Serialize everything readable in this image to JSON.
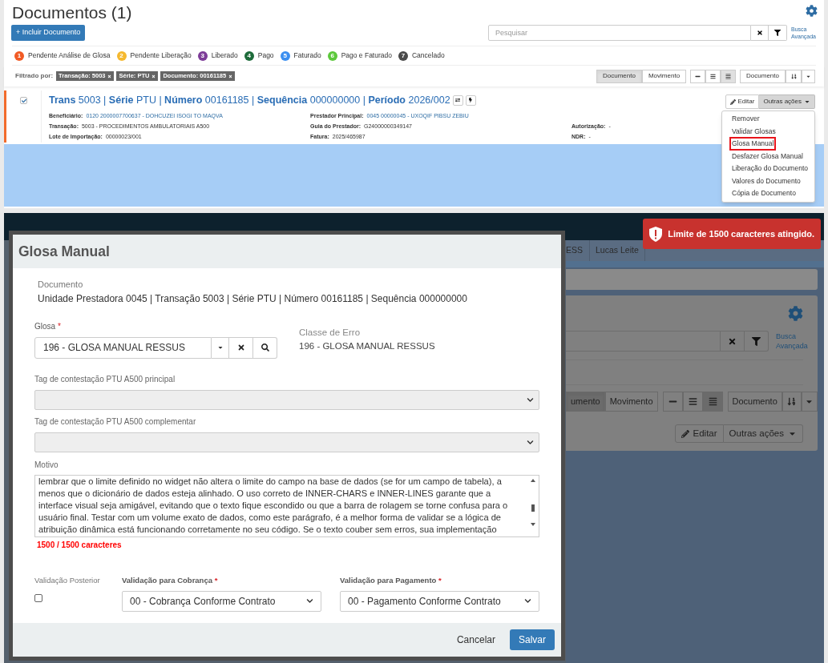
{
  "list_page": {
    "title": "Documentos (1)",
    "add_button": "+ Incluir Documento",
    "search": {
      "placeholder": "Pesquisar"
    },
    "advanced_search": "Busca Avançada",
    "legend": [
      {
        "number": "1",
        "label": "Pendente Análise de Glosa",
        "color": "#f15a24"
      },
      {
        "number": "2",
        "label": "Pendente Liberação",
        "color": "#f5b82e"
      },
      {
        "number": "3",
        "label": "Liberado",
        "color": "#7d3c98"
      },
      {
        "number": "4",
        "label": "Pago",
        "color": "#1d6b3a"
      },
      {
        "number": "5",
        "label": "Faturado",
        "color": "#3b8ff0"
      },
      {
        "number": "6",
        "label": "Pago e Faturado",
        "color": "#5cc83b"
      },
      {
        "number": "7",
        "label": "Cancelado",
        "color": "#4a4a4a"
      }
    ],
    "filter_label": "Filtrado por:",
    "filters": [
      "Transação: 5003",
      "Série: PTU",
      "Documento: 00161185"
    ],
    "view_toggle": [
      {
        "label": "Documento",
        "selected": true
      },
      {
        "label": "Movimento",
        "selected": false
      }
    ],
    "density": [
      {
        "kind": "single",
        "selected": false
      },
      {
        "kind": "list",
        "selected": false
      },
      {
        "kind": "detailed",
        "selected": true
      }
    ],
    "sort_label": "Documento",
    "document": {
      "checked": true,
      "heading": "**Trans** 5003 | **Série** PTU | **Número** 00161185 | **Sequência** 000000000 | **Período** 2026/002",
      "detail_rows": [
        [
          {
            "label": "Beneficiário:",
            "value": "0120 2000007700637 - DOHCUZEI ISOGI TO MAQVA",
            "link": true
          },
          {
            "label": "Prestador Principal:",
            "value": "0045 00000045 - UXOQIF PIBSU ZEBIU",
            "link": true
          }
        ],
        [
          {
            "label": "Transação:",
            "value": "5003 - PROCEDIMENTOS AMBULATORIAIS A500",
            "link": false
          },
          {
            "label": "Guia do Prestador:",
            "value": "G24000000349147",
            "link": false
          },
          {
            "label": "Autorização:",
            "value": "-",
            "link": false
          }
        ],
        [
          {
            "label": "Lote de Importação:",
            "value": "00000023/001",
            "link": false
          },
          {
            "label": "Fatura:",
            "value": "2025/465987",
            "link": false
          },
          {
            "label": "NDR:",
            "value": "-",
            "link": false
          }
        ]
      ],
      "edit_button": "Editar",
      "more_button": "Outras ações",
      "menu": [
        {
          "label": "Remover",
          "selected": false
        },
        {
          "label": "Validar Glosas",
          "selected": false
        },
        {
          "label": "Glosa Manual",
          "selected": true
        },
        {
          "label": "Desfazer Glosa Manual",
          "selected": false
        },
        {
          "label": "Liberação do Documento",
          "selected": false
        },
        {
          "label": "Valores do Documento",
          "selected": false
        },
        {
          "label": "Cópia de Documento",
          "selected": false
        }
      ]
    }
  },
  "background": {
    "tabs": [
      "ESS",
      "Lucas Leite"
    ],
    "advanced_search": "Busca Avançada",
    "view_toggle": [
      {
        "label": "umento",
        "selected": true
      },
      {
        "label": "Movimento",
        "selected": false
      }
    ],
    "density": [
      {
        "kind": "single",
        "selected": false
      },
      {
        "kind": "list",
        "selected": false
      },
      {
        "kind": "detailed",
        "selected": true
      }
    ],
    "sort_label": "Documento",
    "edit_button": "Editar",
    "more_button": "Outras ações",
    "toast": "Limite de 1500 caracteres atingido."
  },
  "dialog": {
    "title": "Glosa Manual",
    "document_label": "Documento",
    "document_value": "Unidade Prestadora 0045 | Transação 5003 | Série PTU | Número 00161185 | Sequência 000000000",
    "glosa": {
      "label": "Glosa",
      "required_mark": "*",
      "value": "196 - GLOSA MANUAL RESSUS"
    },
    "error_class": {
      "label": "Classe de Erro",
      "value": "196 - GLOSA MANUAL RESSUS"
    },
    "tags": [
      {
        "label": "Tag de contestação PTU A500 principal",
        "disabled": true
      },
      {
        "label": "Tag de contestação PTU A500 complementar",
        "disabled": true
      }
    ],
    "reason": {
      "label": "Motivo",
      "text": "lembrar que o limite definido no widget não altera o limite do campo na base de dados (se for um campo de tabela), a menos que o dicionário de dados esteja alinhado. O uso correto de INNER-CHARS e INNER-LINES garante que a interface visual seja amigável, evitando que o texto fique escondido ou que a barra de rolagem se torne confusa para o usuário final. Testar com um volume exato de dados, como este parágrafo, é a melhor forma de validar se a lógica de atribuição dinâmica está funcionando corretamente no seu código. Se o texto couber sem erros, sua implementação",
      "counter": "1500 / 1500 caracteres",
      "at_limit": true
    },
    "later_validation": {
      "label": "Validação Posterior",
      "checked": false
    },
    "selects": [
      {
        "label": "Validação para Cobrança",
        "required_mark": "*",
        "value": "00 - Cobrança Conforme Contrato"
      },
      {
        "label": "Validação para Pagamento",
        "required_mark": "*",
        "value": "00 - Pagamento Conforme Contrato"
      }
    ],
    "cancel_button": "Cancelar",
    "save_button": "Salvar"
  }
}
